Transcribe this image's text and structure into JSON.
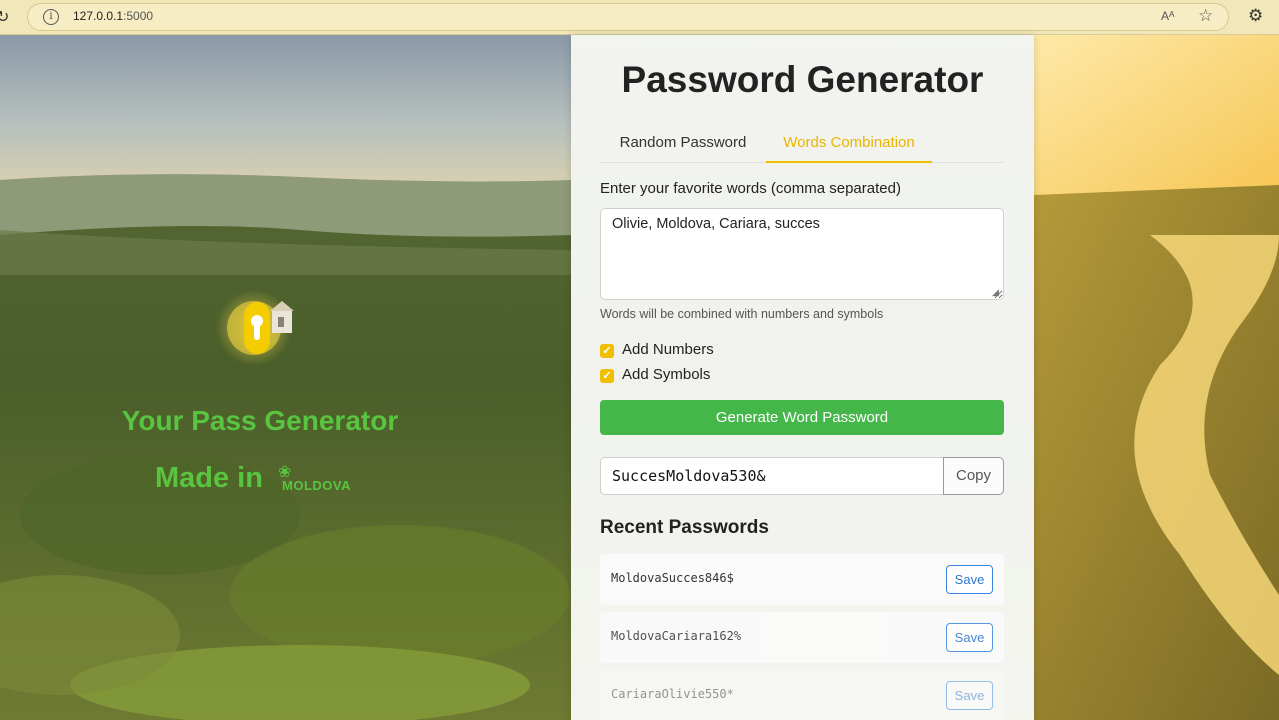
{
  "browser": {
    "url_host": "127.0.0.1",
    "url_port": ":5000",
    "read_aloud": "Aᴬ"
  },
  "hero": {
    "title": "Your Pass Generator",
    "made_in": "Made in",
    "country_mark": "MOLDOVA"
  },
  "card": {
    "title": "Password Generator",
    "tabs": [
      {
        "label": "Random Password",
        "active": false
      },
      {
        "label": "Words Combination",
        "active": true
      }
    ],
    "words_label": "Enter your favorite words (comma separated)",
    "words_value": "Olivie, Moldova, Cariara, succes",
    "hint": "Words will be combined with numbers and symbols",
    "options": [
      {
        "label": "Add Numbers",
        "checked": true
      },
      {
        "label": "Add Symbols",
        "checked": true
      }
    ],
    "generate_label": "Generate Word Password",
    "result_value": "SuccesMoldova530&",
    "copy_label": "Copy",
    "recent_title": "Recent Passwords",
    "recent": [
      {
        "password": "MoldovaSucces846$",
        "action": "Save"
      },
      {
        "password": "MoldovaCariara162%",
        "action": "Save"
      },
      {
        "password": "CariaraOlivie550*",
        "action": "Save"
      }
    ]
  },
  "colors": {
    "accent_yellow": "#f0c000",
    "button_green": "#45b649",
    "hero_green": "#58c440",
    "save_blue": "#2a76d2"
  }
}
